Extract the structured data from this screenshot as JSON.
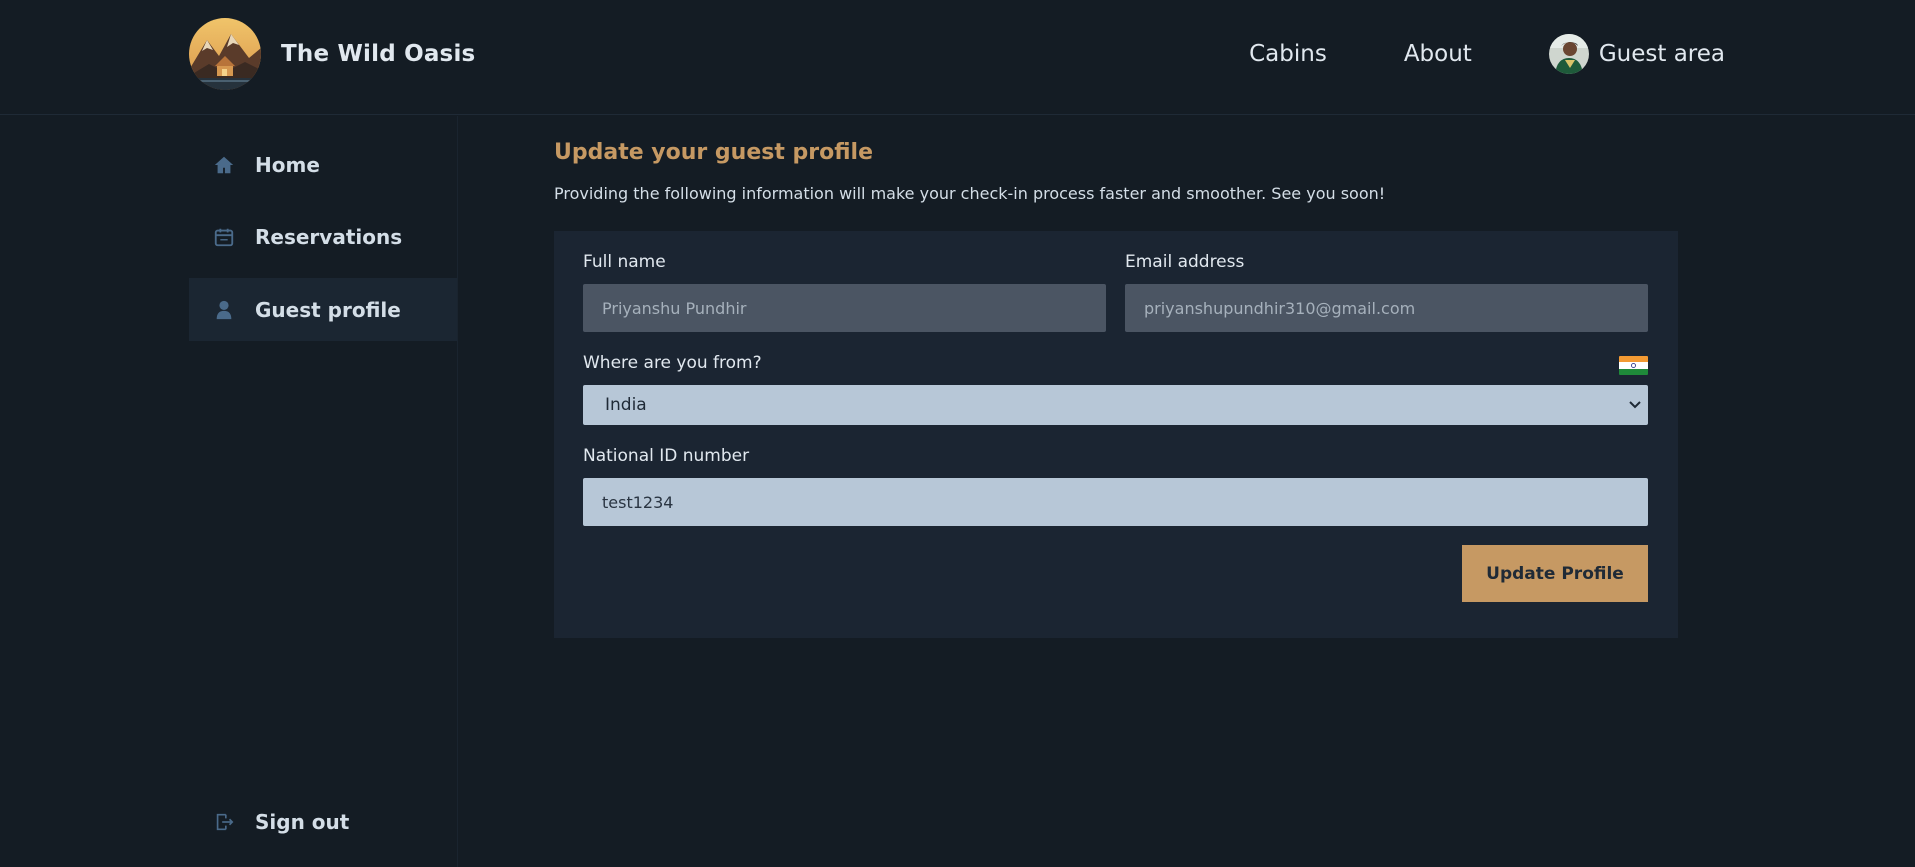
{
  "header": {
    "brand": "The Wild Oasis",
    "nav": [
      {
        "label": "Cabins"
      },
      {
        "label": "About"
      }
    ],
    "guest_area_label": "Guest area"
  },
  "sidebar": {
    "items": [
      {
        "label": "Home",
        "icon": "home-icon",
        "active": false
      },
      {
        "label": "Reservations",
        "icon": "calendar-icon",
        "active": false
      },
      {
        "label": "Guest profile",
        "icon": "user-icon",
        "active": true
      }
    ],
    "sign_out_label": "Sign out"
  },
  "main": {
    "title": "Update your guest profile",
    "subtitle": "Providing the following information will make your check-in process faster and smoother. See you soon!"
  },
  "form": {
    "full_name_label": "Full name",
    "full_name_value": "Priyanshu Pundhir",
    "email_label": "Email address",
    "email_value": "priyanshupundhir310@gmail.com",
    "country_label": "Where are you from?",
    "country_value": "India",
    "national_id_label": "National ID number",
    "national_id_value": "test1234",
    "submit_label": "Update Profile"
  },
  "colors": {
    "background": "#141c24",
    "accent": "#c69963",
    "card": "#1b2532",
    "input_light": "#b7c7d7"
  }
}
